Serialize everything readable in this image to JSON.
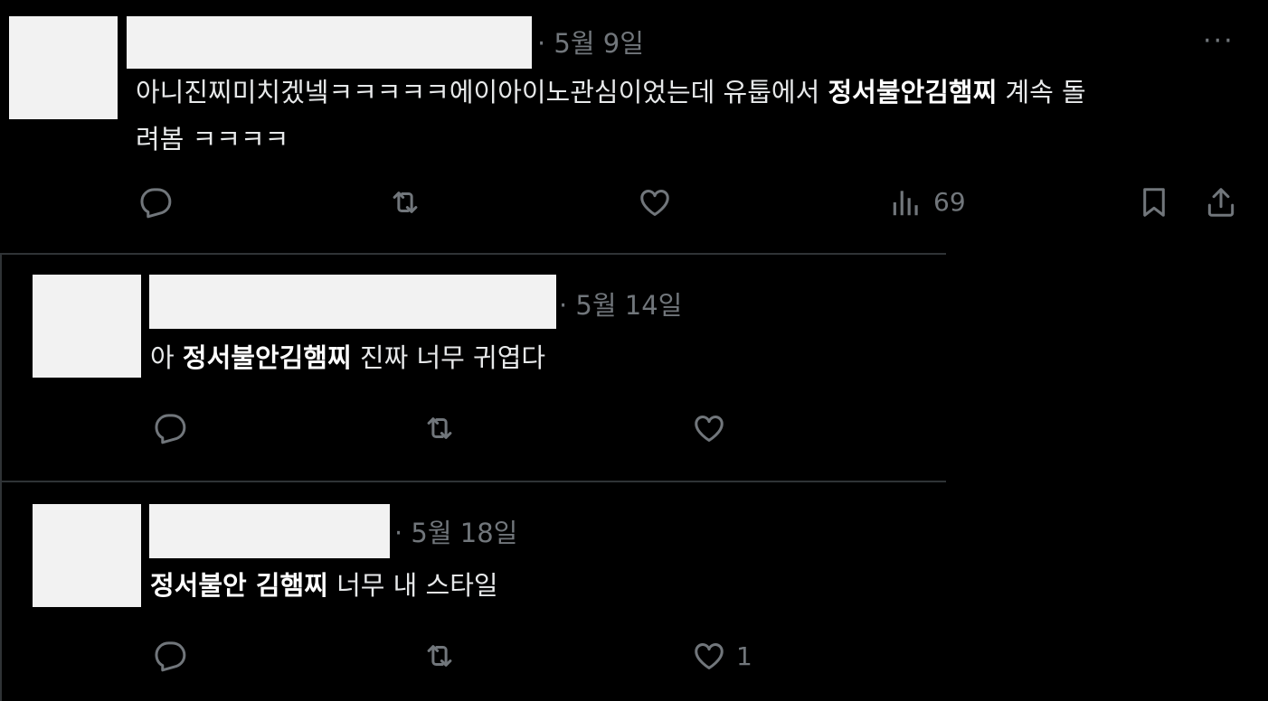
{
  "posts": [
    {
      "date": "· 5월 9일",
      "text_before": "아니진찌미치겠넼ㅋㅋㅋㅋㅋ에이아이노관심이었는데 유툽에서 ",
      "text_bold": "정서불안김햄찌",
      "text_after": " 계속 돌",
      "text_line2": "려봄 ㅋㅋㅋㅋ",
      "views": "69",
      "more_label": "···"
    },
    {
      "date": "· 5월 14일",
      "text_before": "아 ",
      "text_bold": "정서불안김햄찌",
      "text_after": " 진짜 너무 귀엽다"
    },
    {
      "date": "· 5월 18일",
      "text_before": "",
      "text_bold": "정서불안 김햄찌",
      "text_after": " 너무 내 스타일",
      "likes": "1"
    }
  ],
  "icons": {
    "reply": "reply-icon",
    "repost": "repost-icon",
    "like": "like-icon",
    "views": "views-icon",
    "bookmark": "bookmark-icon",
    "share": "share-icon",
    "more": "more-icon"
  },
  "colors": {
    "background": "#000000",
    "text": "#e7e9ea",
    "muted": "#71767b",
    "divider": "#2f3336",
    "redaction": "#f2f2f2"
  }
}
